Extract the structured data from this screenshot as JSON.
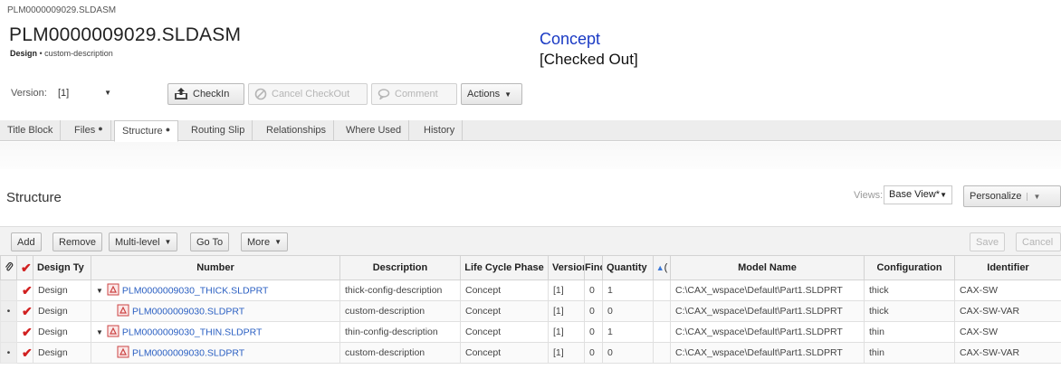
{
  "breadcrumb": "PLM0000009029.SLDASM",
  "title": "PLM0000009029.SLDASM",
  "subtitle": {
    "type": "Design",
    "description": "custom-description"
  },
  "status": {
    "phase": "Concept",
    "state": "[Checked Out]"
  },
  "toolbar": {
    "version_label": "Version:",
    "version_value": "[1]",
    "checkin": "CheckIn",
    "cancel_checkout": "Cancel CheckOut",
    "comment": "Comment",
    "actions": "Actions"
  },
  "tabs": [
    {
      "label": "Title Block",
      "dot": ""
    },
    {
      "label": "Files",
      "dot": "●"
    },
    {
      "label": "Structure",
      "dot": "●"
    },
    {
      "label": "Routing Slip",
      "dot": ""
    },
    {
      "label": "Relationships",
      "dot": ""
    },
    {
      "label": "Where Used",
      "dot": ""
    },
    {
      "label": "History",
      "dot": ""
    }
  ],
  "structure": {
    "title": "Structure",
    "views_label": "Views:",
    "views_value": "Base View",
    "views_mark": "*",
    "personalize": "Personalize",
    "buttons": {
      "add": "Add",
      "remove": "Remove",
      "multilevel": "Multi-level",
      "goto": "Go To",
      "more": "More",
      "save": "Save",
      "cancel": "Cancel"
    },
    "columns": {
      "design_type": "Design Ty",
      "number": "Number",
      "description": "Description",
      "lifecycle": "Life Cycle Phase",
      "version": "Version",
      "find": "Finc",
      "quantity": "Quantity",
      "qty_marker": "(",
      "model": "Model Name",
      "configuration": "Configuration",
      "identifier": "Identifier"
    },
    "rows": [
      {
        "bullet": "",
        "type": "Design",
        "number": "PLM0000009030_THICK.SLDPRT",
        "parent": true,
        "description": "thick-config-description",
        "lifecycle": "Concept",
        "version": "[1]",
        "find": "0",
        "quantity": "1",
        "model": "C:\\CAX_wspace\\Default\\Part1.SLDPRT",
        "configuration": "thick",
        "identifier": "CAX-SW"
      },
      {
        "bullet": "•",
        "type": "Design",
        "number": "PLM0000009030.SLDPRT",
        "parent": false,
        "description": "custom-description",
        "lifecycle": "Concept",
        "version": "[1]",
        "find": "0",
        "quantity": "0",
        "model": "C:\\CAX_wspace\\Default\\Part1.SLDPRT",
        "configuration": "thick",
        "identifier": "CAX-SW-VAR"
      },
      {
        "bullet": "",
        "type": "Design",
        "number": "PLM0000009030_THIN.SLDPRT",
        "parent": true,
        "description": "thin-config-description",
        "lifecycle": "Concept",
        "version": "[1]",
        "find": "0",
        "quantity": "1",
        "model": "C:\\CAX_wspace\\Default\\Part1.SLDPRT",
        "configuration": "thin",
        "identifier": "CAX-SW"
      },
      {
        "bullet": "•",
        "type": "Design",
        "number": "PLM0000009030.SLDPRT",
        "parent": false,
        "description": "custom-description",
        "lifecycle": "Concept",
        "version": "[1]",
        "find": "0",
        "quantity": "0",
        "model": "C:\\CAX_wspace\\Default\\Part1.SLDPRT",
        "configuration": "thin",
        "identifier": "CAX-SW-VAR"
      }
    ]
  }
}
